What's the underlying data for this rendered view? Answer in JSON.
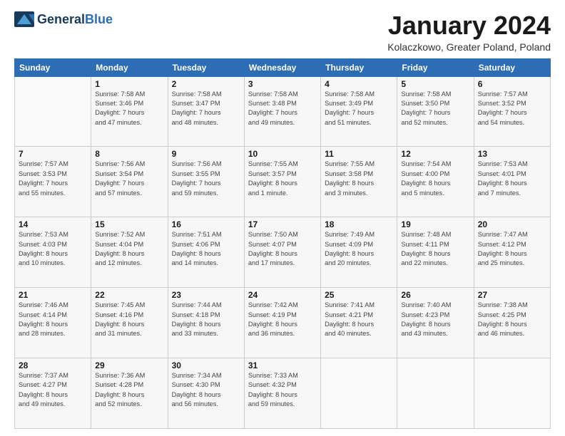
{
  "header": {
    "logo": {
      "general": "General",
      "blue": "Blue"
    },
    "title": "January 2024",
    "subtitle": "Kolaczkowo, Greater Poland, Poland"
  },
  "weekdays": [
    "Sunday",
    "Monday",
    "Tuesday",
    "Wednesday",
    "Thursday",
    "Friday",
    "Saturday"
  ],
  "weeks": [
    [
      {
        "day": "",
        "info": ""
      },
      {
        "day": "1",
        "info": "Sunrise: 7:58 AM\nSunset: 3:46 PM\nDaylight: 7 hours\nand 47 minutes."
      },
      {
        "day": "2",
        "info": "Sunrise: 7:58 AM\nSunset: 3:47 PM\nDaylight: 7 hours\nand 48 minutes."
      },
      {
        "day": "3",
        "info": "Sunrise: 7:58 AM\nSunset: 3:48 PM\nDaylight: 7 hours\nand 49 minutes."
      },
      {
        "day": "4",
        "info": "Sunrise: 7:58 AM\nSunset: 3:49 PM\nDaylight: 7 hours\nand 51 minutes."
      },
      {
        "day": "5",
        "info": "Sunrise: 7:58 AM\nSunset: 3:50 PM\nDaylight: 7 hours\nand 52 minutes."
      },
      {
        "day": "6",
        "info": "Sunrise: 7:57 AM\nSunset: 3:52 PM\nDaylight: 7 hours\nand 54 minutes."
      }
    ],
    [
      {
        "day": "7",
        "info": "Sunrise: 7:57 AM\nSunset: 3:53 PM\nDaylight: 7 hours\nand 55 minutes."
      },
      {
        "day": "8",
        "info": "Sunrise: 7:56 AM\nSunset: 3:54 PM\nDaylight: 7 hours\nand 57 minutes."
      },
      {
        "day": "9",
        "info": "Sunrise: 7:56 AM\nSunset: 3:55 PM\nDaylight: 7 hours\nand 59 minutes."
      },
      {
        "day": "10",
        "info": "Sunrise: 7:55 AM\nSunset: 3:57 PM\nDaylight: 8 hours\nand 1 minute."
      },
      {
        "day": "11",
        "info": "Sunrise: 7:55 AM\nSunset: 3:58 PM\nDaylight: 8 hours\nand 3 minutes."
      },
      {
        "day": "12",
        "info": "Sunrise: 7:54 AM\nSunset: 4:00 PM\nDaylight: 8 hours\nand 5 minutes."
      },
      {
        "day": "13",
        "info": "Sunrise: 7:53 AM\nSunset: 4:01 PM\nDaylight: 8 hours\nand 7 minutes."
      }
    ],
    [
      {
        "day": "14",
        "info": "Sunrise: 7:53 AM\nSunset: 4:03 PM\nDaylight: 8 hours\nand 10 minutes."
      },
      {
        "day": "15",
        "info": "Sunrise: 7:52 AM\nSunset: 4:04 PM\nDaylight: 8 hours\nand 12 minutes."
      },
      {
        "day": "16",
        "info": "Sunrise: 7:51 AM\nSunset: 4:06 PM\nDaylight: 8 hours\nand 14 minutes."
      },
      {
        "day": "17",
        "info": "Sunrise: 7:50 AM\nSunset: 4:07 PM\nDaylight: 8 hours\nand 17 minutes."
      },
      {
        "day": "18",
        "info": "Sunrise: 7:49 AM\nSunset: 4:09 PM\nDaylight: 8 hours\nand 20 minutes."
      },
      {
        "day": "19",
        "info": "Sunrise: 7:48 AM\nSunset: 4:11 PM\nDaylight: 8 hours\nand 22 minutes."
      },
      {
        "day": "20",
        "info": "Sunrise: 7:47 AM\nSunset: 4:12 PM\nDaylight: 8 hours\nand 25 minutes."
      }
    ],
    [
      {
        "day": "21",
        "info": "Sunrise: 7:46 AM\nSunset: 4:14 PM\nDaylight: 8 hours\nand 28 minutes."
      },
      {
        "day": "22",
        "info": "Sunrise: 7:45 AM\nSunset: 4:16 PM\nDaylight: 8 hours\nand 31 minutes."
      },
      {
        "day": "23",
        "info": "Sunrise: 7:44 AM\nSunset: 4:18 PM\nDaylight: 8 hours\nand 33 minutes."
      },
      {
        "day": "24",
        "info": "Sunrise: 7:42 AM\nSunset: 4:19 PM\nDaylight: 8 hours\nand 36 minutes."
      },
      {
        "day": "25",
        "info": "Sunrise: 7:41 AM\nSunset: 4:21 PM\nDaylight: 8 hours\nand 40 minutes."
      },
      {
        "day": "26",
        "info": "Sunrise: 7:40 AM\nSunset: 4:23 PM\nDaylight: 8 hours\nand 43 minutes."
      },
      {
        "day": "27",
        "info": "Sunrise: 7:38 AM\nSunset: 4:25 PM\nDaylight: 8 hours\nand 46 minutes."
      }
    ],
    [
      {
        "day": "28",
        "info": "Sunrise: 7:37 AM\nSunset: 4:27 PM\nDaylight: 8 hours\nand 49 minutes."
      },
      {
        "day": "29",
        "info": "Sunrise: 7:36 AM\nSunset: 4:28 PM\nDaylight: 8 hours\nand 52 minutes."
      },
      {
        "day": "30",
        "info": "Sunrise: 7:34 AM\nSunset: 4:30 PM\nDaylight: 8 hours\nand 56 minutes."
      },
      {
        "day": "31",
        "info": "Sunrise: 7:33 AM\nSunset: 4:32 PM\nDaylight: 8 hours\nand 59 minutes."
      },
      {
        "day": "",
        "info": ""
      },
      {
        "day": "",
        "info": ""
      },
      {
        "day": "",
        "info": ""
      }
    ]
  ]
}
